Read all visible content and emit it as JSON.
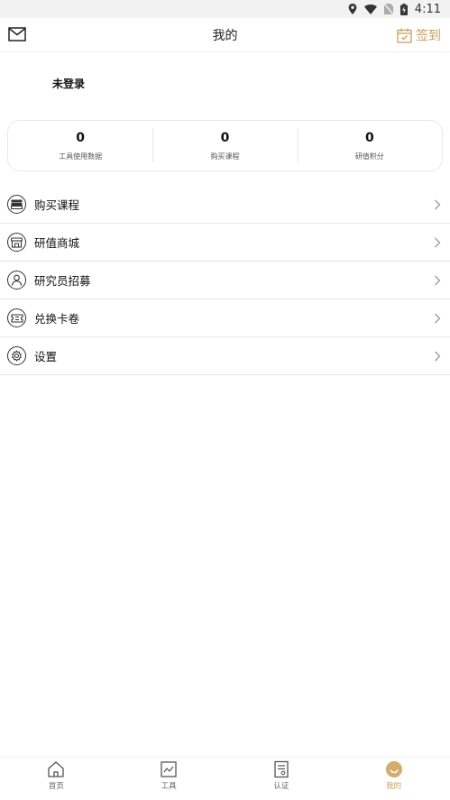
{
  "status_bar": {
    "time": "4:11"
  },
  "header": {
    "title": "我的",
    "checkin_label": "签到"
  },
  "user": {
    "login_label": "未登录"
  },
  "stats": [
    {
      "value": "0",
      "label": "工具使用数据"
    },
    {
      "value": "0",
      "label": "购买课程"
    },
    {
      "value": "0",
      "label": "研值积分"
    }
  ],
  "menu": [
    {
      "label": "购买课程",
      "icon": "course-list-icon"
    },
    {
      "label": "研值商城",
      "icon": "store-icon"
    },
    {
      "label": "研究员招募",
      "icon": "user-icon"
    },
    {
      "label": "兑换卡卷",
      "icon": "ticket-icon"
    },
    {
      "label": "设置",
      "icon": "gear-icon"
    }
  ],
  "tabbar": [
    {
      "label": "首页",
      "icon": "home-icon"
    },
    {
      "label": "工具",
      "icon": "chart-icon"
    },
    {
      "label": "认证",
      "icon": "certificate-icon"
    },
    {
      "label": "我的",
      "icon": "smiley-icon",
      "active": true
    }
  ],
  "colors": {
    "accent": "#c8a05a",
    "divider": "#e5e5e5",
    "text": "#111111"
  }
}
